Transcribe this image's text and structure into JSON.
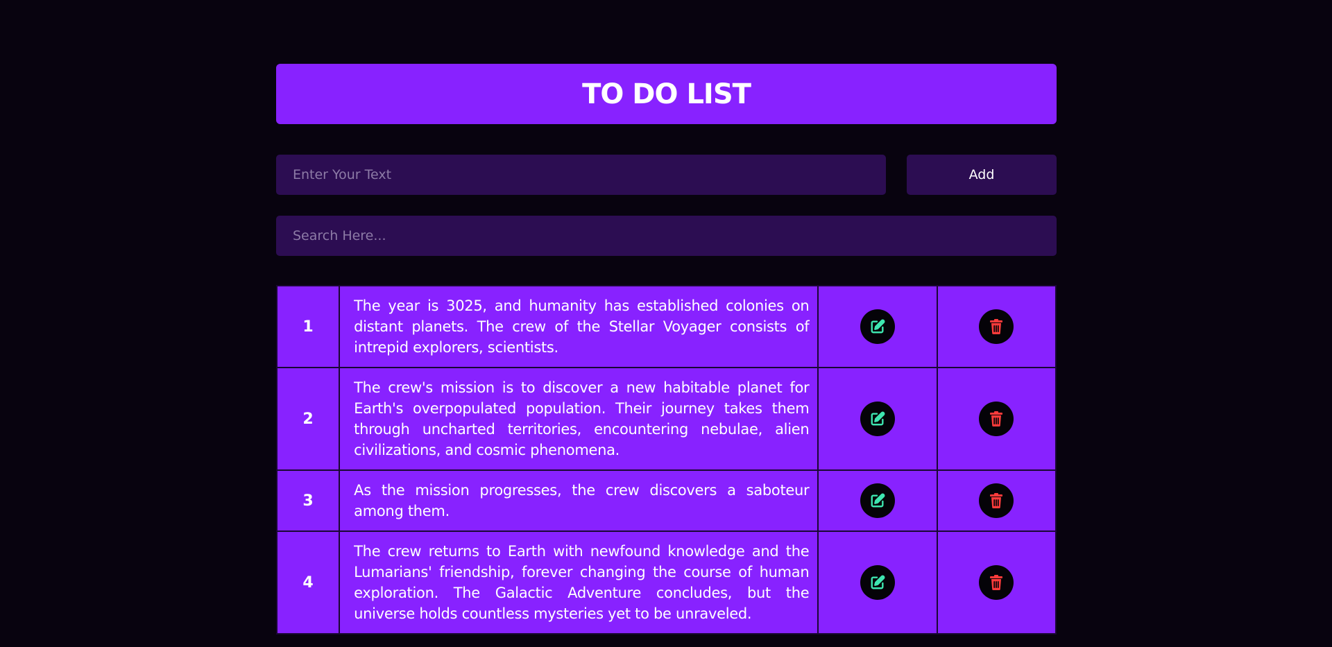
{
  "header": {
    "title": "TO DO LIST"
  },
  "add_form": {
    "input_placeholder": "Enter Your Text",
    "input_value": "",
    "add_label": "Add"
  },
  "search": {
    "placeholder": "Search Here...",
    "value": ""
  },
  "colors": {
    "background": "#08030f",
    "accent": "#8822ff",
    "input_bg": "#2c0d52",
    "edit_icon": "#3ee6b0",
    "delete_icon": "#ff3b3b"
  },
  "todos": [
    {
      "number": "1",
      "text": "The year is 3025, and humanity has established colonies on distant planets. The crew of the Stellar Voyager consists of intrepid explorers, scientists.",
      "edit_icon": "edit-icon",
      "delete_icon": "trash-icon"
    },
    {
      "number": "2",
      "text": "The crew's mission is to discover a new habitable planet for Earth's overpopulated population. Their journey takes them through uncharted territories, encountering nebulae, alien civilizations, and cosmic phenomena.",
      "edit_icon": "edit-icon",
      "delete_icon": "trash-icon"
    },
    {
      "number": "3",
      "text": "As the mission progresses, the crew discovers a saboteur among them.",
      "edit_icon": "edit-icon",
      "delete_icon": "trash-icon"
    },
    {
      "number": "4",
      "text": "The crew returns to Earth with newfound knowledge and the Lumarians' friendship, forever changing the course of human exploration. The Galactic Adventure concludes, but the universe holds countless mysteries yet to be unraveled.",
      "edit_icon": "edit-icon",
      "delete_icon": "trash-icon"
    }
  ]
}
